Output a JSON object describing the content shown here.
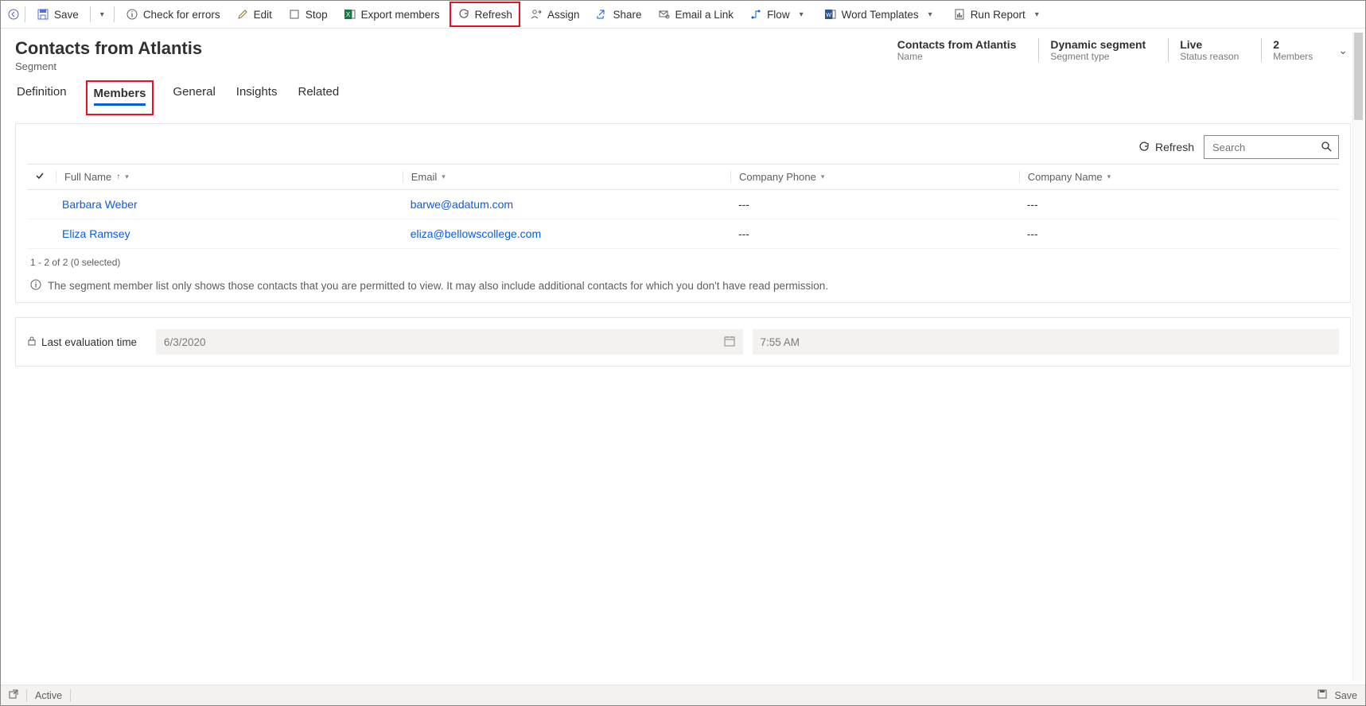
{
  "toolbar": {
    "save": "Save",
    "check_errors": "Check for errors",
    "edit": "Edit",
    "stop": "Stop",
    "export_members": "Export members",
    "refresh": "Refresh",
    "assign": "Assign",
    "share": "Share",
    "email_link": "Email a Link",
    "flow": "Flow",
    "word_templates": "Word Templates",
    "run_report": "Run Report"
  },
  "header": {
    "title": "Contacts from Atlantis",
    "subtitle": "Segment",
    "summary": [
      {
        "value": "Contacts from Atlantis",
        "label": "Name"
      },
      {
        "value": "Dynamic segment",
        "label": "Segment type"
      },
      {
        "value": "Live",
        "label": "Status reason"
      },
      {
        "value": "2",
        "label": "Members"
      }
    ]
  },
  "tabs": {
    "definition": "Definition",
    "members": "Members",
    "general": "General",
    "insights": "Insights",
    "related": "Related"
  },
  "members_panel": {
    "refresh": "Refresh",
    "search_placeholder": "Search",
    "columns": {
      "full_name": "Full Name",
      "email": "Email",
      "company_phone": "Company Phone",
      "company_name": "Company Name"
    },
    "rows": [
      {
        "full_name": "Barbara Weber",
        "email": "barwe@adatum.com",
        "company_phone": "---",
        "company_name": "---"
      },
      {
        "full_name": "Eliza Ramsey",
        "email": "eliza@bellowscollege.com",
        "company_phone": "---",
        "company_name": "---"
      }
    ],
    "footer": "1 - 2 of 2 (0 selected)",
    "info": "The segment member list only shows those contacts that you are permitted to view. It may also include additional contacts for which you don't have read permission."
  },
  "evaluation": {
    "label": "Last evaluation time",
    "date": "6/3/2020",
    "time": "7:55 AM"
  },
  "statusbar": {
    "state": "Active",
    "save": "Save"
  }
}
